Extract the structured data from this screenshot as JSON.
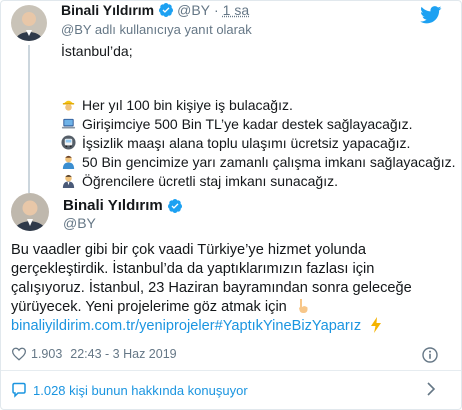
{
  "quoted": {
    "author_name": "Binali Yıldırım",
    "handle": "@BY",
    "separator": "·",
    "time": "1 sa",
    "reply_to": "@BY adlı kullanıcıya yanıt olarak",
    "lines": [
      "İstanbul’da;",
      "Her yıl 100 bin kişiye iş bulacağız.",
      "Girişimciye 500 Bin TL’ye kadar destek sağlayacağız.",
      "İşsizlik maaşı alana toplu ulaşımı ücretsiz yapacağız.",
      "50 Bin gencimize yarı zamanlı çalışma imkanı sağlayacağız.",
      "Öğrencilere ücretli staj imkanı sunacağız."
    ]
  },
  "tweet": {
    "author_name": "Binali Yıldırım",
    "handle": "@BY",
    "body_lines": [
      "Bu vaadler gibi bir çok vaadi Türkiye’ye hizmet yolunda",
      "gerçekleştirdik. İstanbul’da da yaptıklarımızın fazlası için",
      "çalışıyoruz. İstanbul, 23 Haziran bayramından sonra geleceğe",
      "yürüyecek. Yeni projelerime göz atmak için"
    ],
    "link": "binaliyildirim.com.tr/yeniprojeler",
    "hashtag": "#YaptıkYineBizYaparız",
    "likes": "1.903",
    "timestamp": "22:43 - 3 Haz 2019"
  },
  "footer": {
    "conversation": "1.028 kişi bunun hakkında konuşuyor"
  },
  "colors": {
    "link": "#1b95e0",
    "muted": "#657786",
    "verified": "#1da1f2"
  },
  "icons": {
    "verified": "verified-badge-icon",
    "twitter": "twitter-bird-icon",
    "like": "heart-icon",
    "info": "info-icon",
    "conversation": "speech-bubble-icon",
    "chevron": "chevron-right-icon"
  }
}
